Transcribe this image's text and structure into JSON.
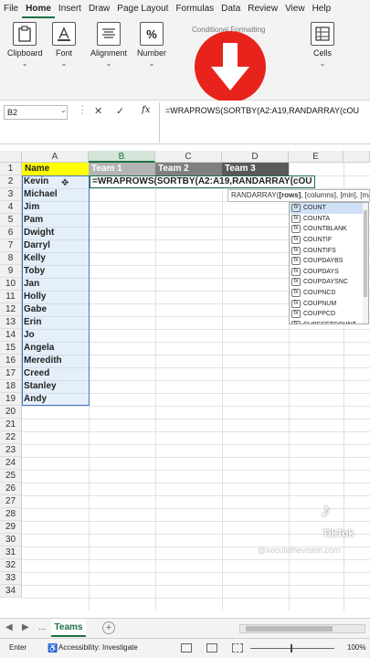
{
  "menu": {
    "tabs": [
      "File",
      "Home",
      "Insert",
      "Draw",
      "Page Layout",
      "Formulas",
      "Data",
      "Review",
      "View",
      "Help"
    ],
    "active": "Home"
  },
  "ribbon": {
    "clipboard": "Clipboard",
    "font": "Font",
    "alignment": "Alignment",
    "number": "Number",
    "conditional_formatting": "Conditional Formatting",
    "cells": "Cells"
  },
  "formula_bar": {
    "name_box": "B2",
    "formula": "=WRAPROWS(SORTBY(A2:A19,RANDARRAY(cOU"
  },
  "columns": [
    "A",
    "B",
    "C",
    "D",
    "E"
  ],
  "rows": [
    "1",
    "2",
    "3",
    "4",
    "5",
    "6",
    "7",
    "8",
    "9",
    "10",
    "11",
    "12",
    "13",
    "14",
    "15",
    "16",
    "17",
    "18",
    "19",
    "20",
    "21",
    "22",
    "23",
    "24",
    "25",
    "26",
    "27",
    "28",
    "29",
    "30",
    "31",
    "32",
    "33",
    "34"
  ],
  "headers": {
    "name": "Name",
    "team1": "Team 1",
    "team2": "Team 2",
    "team3": "Team 3"
  },
  "names": [
    "Kevin",
    "Michael",
    "Jim",
    "Pam",
    "Dwight",
    "Darryl",
    "Kelly",
    "Toby",
    "Jan",
    "Holly",
    "Gabe",
    "Erin",
    "Jo",
    "Angela",
    "Meredith",
    "Creed",
    "Stanley",
    "Andy"
  ],
  "editing_cell": "=WRAPROWS(SORTBY(A2:A19,RANDARRAY(cOU",
  "tooltip": {
    "fn": "RANDARRAY(",
    "bold": "[rows]",
    "rest": ", [columns], [min], [max"
  },
  "autocomplete": [
    "COUNT",
    "COUNTA",
    "COUNTBLANK",
    "COUNTIF",
    "COUNTIFS",
    "COUPDAYBS",
    "COUPDAYS",
    "COUPDAYSNC",
    "COUPNCD",
    "COUPNUM",
    "COUPPCD",
    "CUBESETCOUNT"
  ],
  "sheet": {
    "nav_prev": "◀",
    "nav_next": "▶",
    "more": "...",
    "tab": "Teams",
    "add": "+"
  },
  "status": {
    "mode": "Enter",
    "accessibility": "Accessibility: Investigate",
    "zoom": "100%"
  },
  "overlay": {
    "tiktok": "TikTok",
    "watermark": "@xecutethevision.com"
  },
  "colors": {
    "accent": "#1e7145",
    "header_yellow": "#ffff00",
    "team1_fill": "#b4b4b4",
    "team2_fill": "#7f7f7f",
    "team3_fill": "#595959",
    "arrow_red": "#e8231b"
  }
}
